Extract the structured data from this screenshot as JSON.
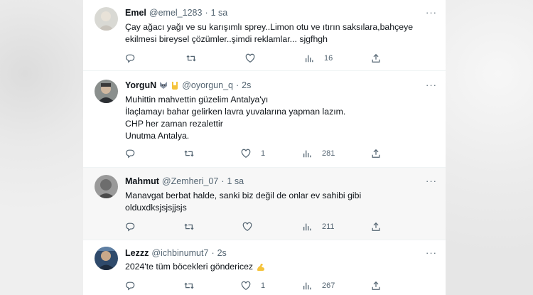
{
  "tweets": [
    {
      "name": "Emel",
      "handle": "@emel_1283",
      "dot": "·",
      "time": "1 sa",
      "text": "Çay ağacı yağı ve su karışımlı sprey..Limon otu ve ıtırın saksılara,bahçeye\nekilmesi bireysel çözümler..şimdi reklamlar... sjgfhgh",
      "like_count": "",
      "views": "16"
    },
    {
      "name": "YorguN",
      "name_emojis": [
        "wolf-emoji",
        "horns-hand-emoji"
      ],
      "handle": "@oyorgun_q",
      "dot": "·",
      "time": "2s",
      "text": "Muhittin mahvettin güzelim Antalya'yı\nİlaçlamayı bahar gelirken lavra yuvalarına yapman lazım.\nCHP her zaman rezalettir\nUnutma Antalya.",
      "like_count": "1",
      "views": "281"
    },
    {
      "name": "Mahmut",
      "handle": "@Zemheri_07",
      "dot": "·",
      "time": "1 sa",
      "text": "Manavgat berbat halde, sanki biz değil de onlar ev sahibi gibi\nolduxdksjsjsjjsjs",
      "like_count": "",
      "views": "211"
    },
    {
      "name": "Lezzz",
      "handle": "@ichbinumut7",
      "dot": "·",
      "time": "2s",
      "text": "2024'te tüm böcekleri göndericez",
      "text_emoji": "flexed-biceps-emoji",
      "like_count": "1",
      "views": "267"
    }
  ],
  "more_label": "···",
  "colors": {
    "text": "#0f1419",
    "secondary": "#536471",
    "divider": "#eff3f4"
  }
}
